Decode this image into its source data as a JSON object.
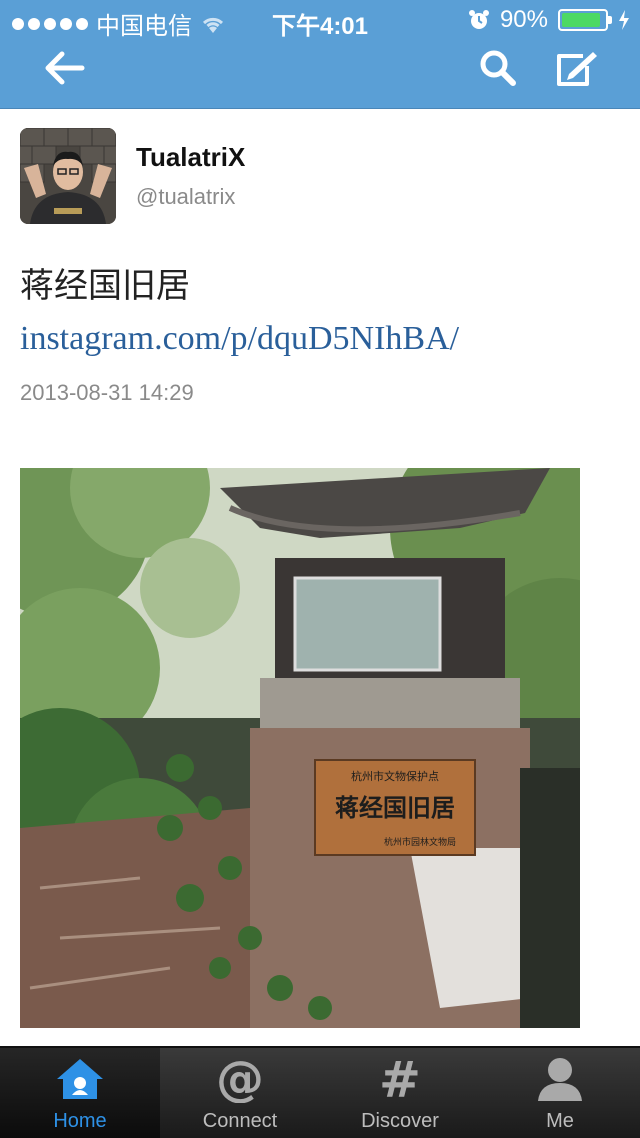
{
  "status_bar": {
    "carrier": "中国电信",
    "time": "下午4:01",
    "battery_percent": "90%",
    "battery_level": 0.9,
    "signal_bars": 5
  },
  "nav": {
    "back_icon": "back-arrow-icon",
    "search_icon": "search-icon",
    "compose_icon": "compose-icon"
  },
  "tweet": {
    "display_name": "TualatriX",
    "username": "@tualatrix",
    "text": "蒋经国旧居 ",
    "link": "instagram.com/p/dquD5NIhBA/",
    "timestamp": "2013-08-31 14:29"
  },
  "photo": {
    "sign_line1": "杭州市文物保护点",
    "sign_line2": "蒋经国旧居",
    "sign_line3": "杭州市园林文物局"
  },
  "tabbar": {
    "items": [
      {
        "label": "Home",
        "icon": "home-icon",
        "active": true
      },
      {
        "label": "Connect",
        "icon": "at-icon",
        "active": false
      },
      {
        "label": "Discover",
        "icon": "hash-icon",
        "active": false
      },
      {
        "label": "Me",
        "icon": "person-icon",
        "active": false
      }
    ]
  },
  "colors": {
    "nav_blue": "#5a9fd6",
    "link_blue": "#2a5f9a",
    "tab_active": "#2e91e6",
    "battery_green": "#4cd964"
  }
}
